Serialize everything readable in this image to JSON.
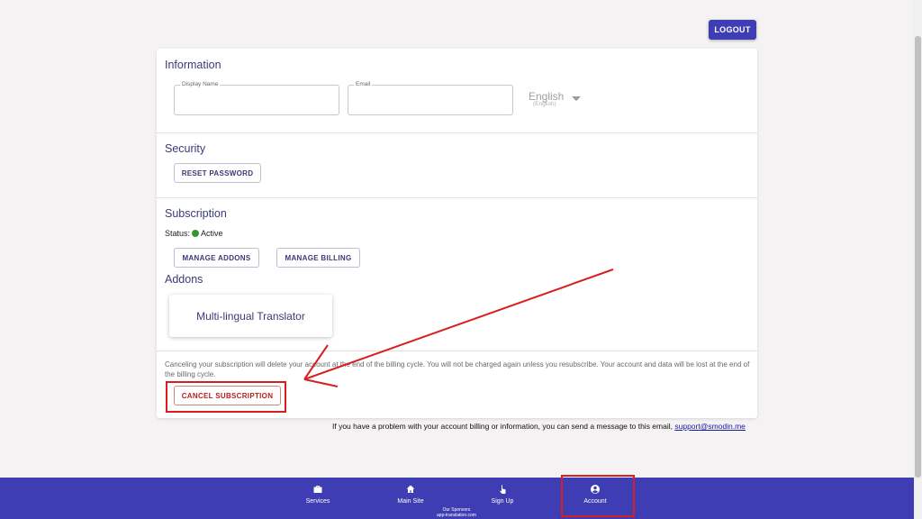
{
  "header": {
    "logout_label": "LOGOUT"
  },
  "information": {
    "title": "Information",
    "display_name": {
      "label": "Display Name",
      "value": "",
      "placeholder": ""
    },
    "email": {
      "label": "Email",
      "value": "",
      "placeholder": ""
    },
    "language": {
      "selected": "English",
      "native": "(English)"
    }
  },
  "security": {
    "title": "Security",
    "reset_password_label": "RESET PASSWORD"
  },
  "subscription": {
    "title": "Subscription",
    "status_label": "Status:",
    "status_value": "Active",
    "status_color": "#2e9a2e",
    "manage_addons_label": "MANAGE ADDONS",
    "manage_billing_label": "MANAGE BILLING"
  },
  "addons": {
    "title": "Addons",
    "items": [
      {
        "name": "Multi-lingual Translator"
      }
    ]
  },
  "cancellation": {
    "note": "Canceling your subscription will delete your account at the end of the billing cycle. You will not be charged again unless you resubscribe. Your account and data will be lost at the end of the billing cycle.",
    "cancel_label": "CANCEL SUBSCRIPTION"
  },
  "support": {
    "text": "If you have a problem with your account billing or information, you can send a message to this email,",
    "email": "support@smodin.me"
  },
  "footer": {
    "nav": [
      {
        "label": "Services",
        "icon": "briefcase-icon"
      },
      {
        "label": "Main Site",
        "icon": "home-icon"
      },
      {
        "label": "Sign Up",
        "icon": "touch-icon"
      },
      {
        "label": "Account",
        "icon": "account-circle-icon"
      }
    ],
    "sponsors_title": "Our Sponsors",
    "sponsor": "app-translation.com"
  },
  "colors": {
    "brand": "#3f3db3",
    "annotation": "#d62020",
    "background": "#f4f2f3"
  }
}
